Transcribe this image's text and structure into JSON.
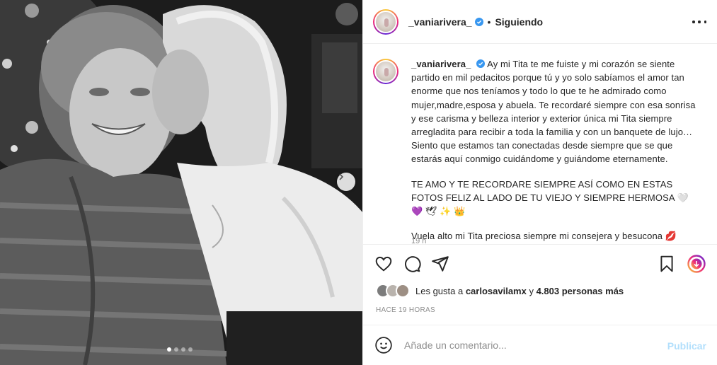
{
  "post": {
    "username": "_vaniarivera_",
    "follow_status": "Siguiendo",
    "separator": "•",
    "caption_user": "_vaniarivera_",
    "caption_paragraphs": [
      "Ay mi Tita te me fuiste y mi corazón se siente partido en mil pedacitos porque tú y yo solo sabíamos el amor tan enorme que nos teníamos y todo lo que te he admirado como mujer,madre,esposa y abuela. Te recordaré siempre con esa sonrisa y ese carisma y belleza interior y exterior única mi Tita siempre arregladita para recibir a toda la familia y con un banquete de lujo… Siento que estamos tan conectadas desde siempre que se que estarás aquí conmigo cuidándome y guiándome eternamente.",
      "TE AMO Y TE RECORDARE SIEMPRE ASÍ COMO EN ESTAS FOTOS FELIZ AL LADO DE TU VIEJO Y SIEMPRE HERMOSA 🤍 💜 🕊 ✨ 👑",
      "Vuela alto mi Tita preciosa siempre mi consejera y besucona 💋"
    ],
    "caption_time": "19 h",
    "likes": {
      "prefix": "Les gusta a ",
      "user": "carlosavilamx",
      "middle": " y ",
      "count": "4.803 personas más"
    },
    "time_ago": "HACE 19 HORAS"
  },
  "comment": {
    "placeholder": "Añade un comentario...",
    "post_label": "Publicar"
  },
  "carousel": {
    "total": 4,
    "active_index": 0
  },
  "colors": {
    "verified_blue": "#3897f0",
    "post_button_disabled": "#b2dffc",
    "reels_gradient": [
      "#f9ce34",
      "#ee2a7b",
      "#6228d7"
    ]
  },
  "icons": [
    "verified-badge-icon",
    "more-options-icon",
    "like-heart-icon",
    "comment-icon",
    "share-icon",
    "save-bookmark-icon",
    "reel-icon",
    "emoji-icon",
    "carousel-next-icon"
  ]
}
